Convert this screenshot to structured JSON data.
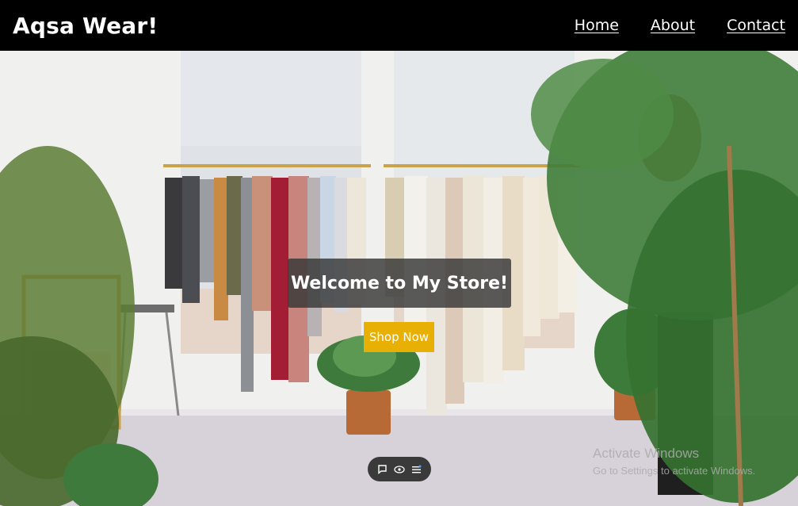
{
  "navbar": {
    "brand": "Aqsa Wear!",
    "links": [
      "Home",
      "About",
      "Contact"
    ]
  },
  "hero": {
    "welcome": "Welcome to My Store!",
    "cta_label": "Shop Now"
  },
  "toolbar": {
    "icons": [
      "comment-icon",
      "eye-icon",
      "menu-icon"
    ]
  },
  "watermark": {
    "title": "Activate Windows",
    "subtitle": "Go to Settings to activate Windows."
  },
  "colors": {
    "navbar_bg": "#000000",
    "cta_bg": "#e8b005",
    "welcome_bg": "#373737"
  }
}
